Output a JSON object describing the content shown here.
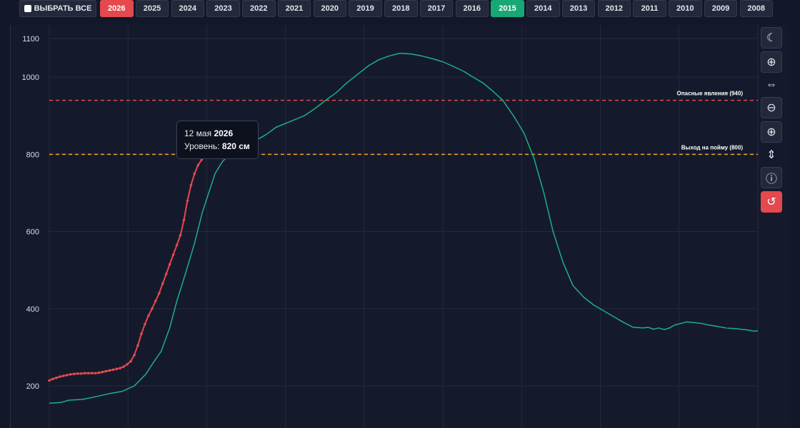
{
  "years_bar": {
    "select_all_label": "ВЫБРАТЬ ВСЕ",
    "years": [
      "2026",
      "2025",
      "2024",
      "2023",
      "2022",
      "2021",
      "2020",
      "2019",
      "2018",
      "2017",
      "2016",
      "2015",
      "2014",
      "2013",
      "2012",
      "2011",
      "2010",
      "2009",
      "2008"
    ],
    "active_red": "2026",
    "active_green": "2015"
  },
  "tooltip": {
    "date_prefix": "12 мая",
    "year": "2026",
    "level_label": "Уровень:",
    "level_value": "820 см"
  },
  "toolbar": {
    "icons": [
      "moon-icon",
      "zoom-in-icon",
      "pan-horizontal-icon",
      "zoom-out-icon",
      "zoom-in-icon",
      "pan-vertical-icon",
      "info-icon",
      "reset-icon"
    ]
  },
  "colors": {
    "series_2026": "#e5484d",
    "series_2015": "#1fae82",
    "danger_line": "#e5484d",
    "flood_line": "#f5a524"
  },
  "chart_data": {
    "type": "line",
    "y_ticks": [
      200,
      400,
      600,
      800,
      1000,
      1100
    ],
    "ylim": [
      130,
      1135
    ],
    "x_range": [
      0,
      100
    ],
    "grid": true,
    "thresholds": [
      {
        "label": "Опасные явления (940)",
        "value": 940,
        "style": "dashed"
      },
      {
        "label": "Выход на пойму (800)",
        "value": 800,
        "style": "dashed"
      }
    ],
    "series": [
      {
        "year": "2015",
        "points": [
          [
            0,
            155
          ],
          [
            1.6,
            157
          ],
          [
            2.8,
            163
          ],
          [
            4.7,
            165
          ],
          [
            6.5,
            172
          ],
          [
            8.5,
            180
          ],
          [
            10.3,
            186
          ],
          [
            12,
            200
          ],
          [
            13.6,
            230
          ],
          [
            14.6,
            258
          ],
          [
            15.8,
            290
          ],
          [
            17,
            350
          ],
          [
            18,
            420
          ],
          [
            19.2,
            490
          ],
          [
            20.5,
            570
          ],
          [
            21.6,
            650
          ],
          [
            22.5,
            700
          ],
          [
            23.4,
            750
          ],
          [
            24.4,
            780
          ],
          [
            25.6,
            805
          ],
          [
            27.1,
            818
          ],
          [
            29,
            835
          ],
          [
            30.5,
            850
          ],
          [
            32,
            870
          ],
          [
            34,
            885
          ],
          [
            36,
            900
          ],
          [
            37.6,
            920
          ],
          [
            39,
            940
          ],
          [
            40.5,
            960
          ],
          [
            42,
            985
          ],
          [
            43.7,
            1010
          ],
          [
            45.1,
            1030
          ],
          [
            46.5,
            1045
          ],
          [
            48,
            1055
          ],
          [
            49.5,
            1062
          ],
          [
            51,
            1060
          ],
          [
            52.5,
            1055
          ],
          [
            54,
            1048
          ],
          [
            55.5,
            1040
          ],
          [
            57,
            1028
          ],
          [
            58.5,
            1015
          ],
          [
            59.8,
            1000
          ],
          [
            61.2,
            985
          ],
          [
            62.5,
            965
          ],
          [
            64,
            940
          ],
          [
            65.5,
            900
          ],
          [
            67,
            855
          ],
          [
            68.4,
            790
          ],
          [
            69.8,
            700
          ],
          [
            71.1,
            600
          ],
          [
            72.5,
            520
          ],
          [
            73.9,
            460
          ],
          [
            75.4,
            430
          ],
          [
            76.8,
            410
          ],
          [
            78.2,
            395
          ],
          [
            79.6,
            380
          ],
          [
            81,
            365
          ],
          [
            82.4,
            352
          ],
          [
            83.8,
            350
          ],
          [
            84.5,
            352
          ],
          [
            85.3,
            347
          ],
          [
            86,
            350
          ],
          [
            86.8,
            346
          ],
          [
            87.5,
            350
          ],
          [
            88.3,
            358
          ],
          [
            89.2,
            362
          ],
          [
            90,
            366
          ],
          [
            91,
            364
          ],
          [
            92,
            362
          ],
          [
            93,
            358
          ],
          [
            94,
            355
          ],
          [
            95.5,
            350
          ],
          [
            97,
            348
          ],
          [
            98.5,
            345
          ],
          [
            99.4,
            342
          ],
          [
            100,
            343
          ]
        ]
      },
      {
        "year": "2026",
        "points": [
          [
            0,
            214
          ],
          [
            0.5,
            218
          ],
          [
            1,
            221
          ],
          [
            1.5,
            224
          ],
          [
            2,
            226
          ],
          [
            2.5,
            228
          ],
          [
            3,
            230
          ],
          [
            3.5,
            231
          ],
          [
            4,
            232
          ],
          [
            4.5,
            232
          ],
          [
            5,
            233
          ],
          [
            5.5,
            233
          ],
          [
            6,
            233
          ],
          [
            6.5,
            233
          ],
          [
            7,
            234
          ],
          [
            7.5,
            236
          ],
          [
            8,
            238
          ],
          [
            8.5,
            240
          ],
          [
            9,
            242
          ],
          [
            9.5,
            244
          ],
          [
            10,
            246
          ],
          [
            10.5,
            250
          ],
          [
            11,
            256
          ],
          [
            11.5,
            264
          ],
          [
            12,
            280
          ],
          [
            12.5,
            305
          ],
          [
            13,
            335
          ],
          [
            13.5,
            360
          ],
          [
            14,
            382
          ],
          [
            14.5,
            400
          ],
          [
            15,
            420
          ],
          [
            15.5,
            440
          ],
          [
            16,
            465
          ],
          [
            16.5,
            490
          ],
          [
            17,
            515
          ],
          [
            17.5,
            540
          ],
          [
            18,
            565
          ],
          [
            18.5,
            590
          ],
          [
            19,
            630
          ],
          [
            19.5,
            680
          ],
          [
            20,
            720
          ],
          [
            20.5,
            750
          ],
          [
            21,
            772
          ],
          [
            21.5,
            786
          ],
          [
            22,
            796
          ],
          [
            22.5,
            804
          ],
          [
            23,
            812
          ],
          [
            23.6,
            820
          ]
        ]
      }
    ],
    "highlight_point": {
      "year": "2026",
      "date": "12 мая",
      "y": 820
    }
  }
}
